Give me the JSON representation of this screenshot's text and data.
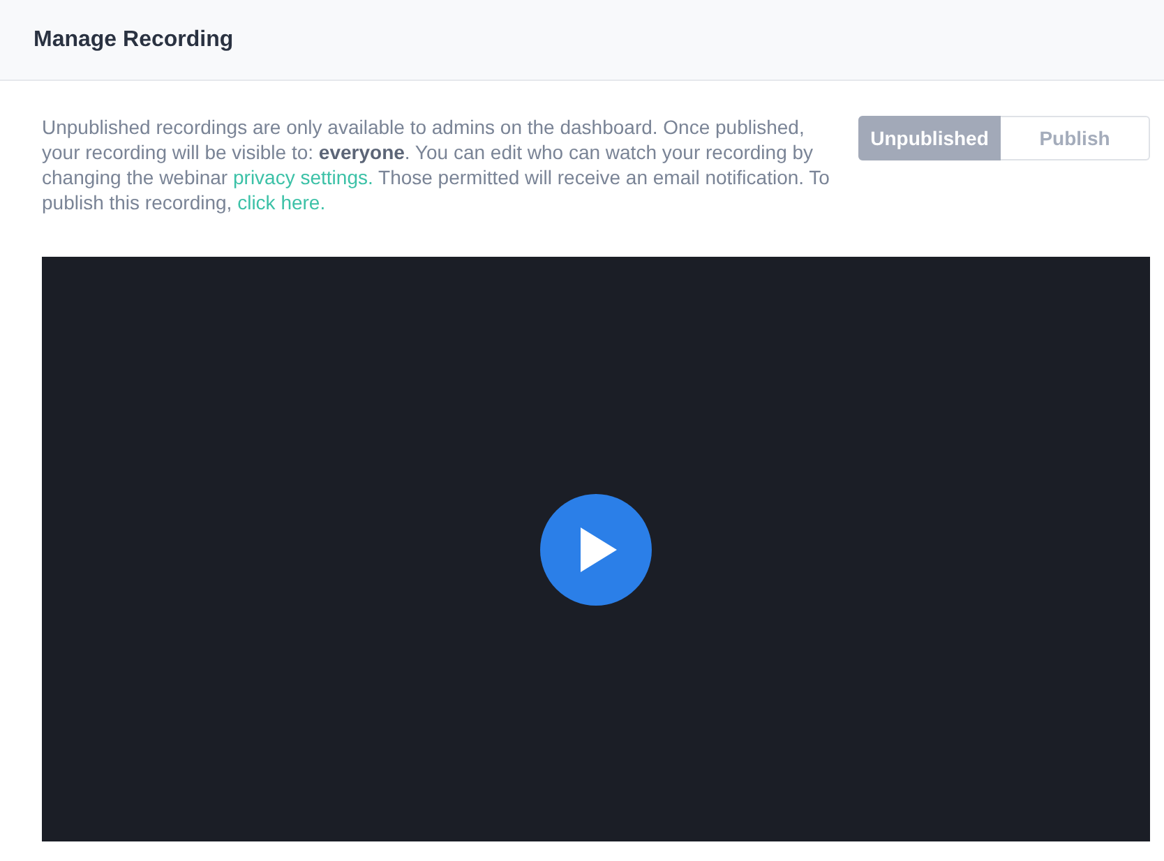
{
  "header": {
    "title": "Manage Recording"
  },
  "description": [
    {
      "kind": "text",
      "text": "Unpublished recordings are only available to admins on the dashboard. Once published, your recording will be visible to: **everyone**. You can edit who can watch your recording by changing the webinar "
    },
    {
      "kind": "link",
      "text": "privacy settings."
    },
    {
      "kind": "text",
      "text": " Those permitted will receive an email notification. To publish this recording, "
    },
    {
      "kind": "link",
      "text": "click here."
    }
  ],
  "publish_toggle": [
    {
      "label": "Unpublished",
      "selected": true
    },
    {
      "label": "Publish",
      "selected": false
    }
  ],
  "video": {
    "play_button": true
  }
}
